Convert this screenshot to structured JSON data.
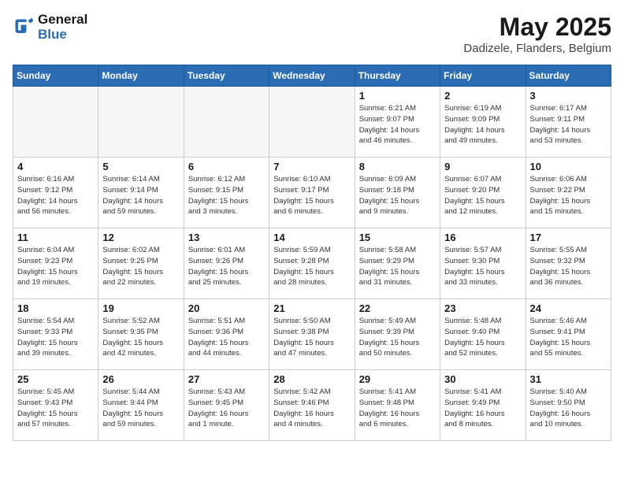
{
  "logo": {
    "line1": "General",
    "line2": "Blue"
  },
  "title": "May 2025",
  "subtitle": "Dadizele, Flanders, Belgium",
  "weekdays": [
    "Sunday",
    "Monday",
    "Tuesday",
    "Wednesday",
    "Thursday",
    "Friday",
    "Saturday"
  ],
  "weeks": [
    [
      {
        "day": "",
        "info": ""
      },
      {
        "day": "",
        "info": ""
      },
      {
        "day": "",
        "info": ""
      },
      {
        "day": "",
        "info": ""
      },
      {
        "day": "1",
        "info": "Sunrise: 6:21 AM\nSunset: 9:07 PM\nDaylight: 14 hours\nand 46 minutes."
      },
      {
        "day": "2",
        "info": "Sunrise: 6:19 AM\nSunset: 9:09 PM\nDaylight: 14 hours\nand 49 minutes."
      },
      {
        "day": "3",
        "info": "Sunrise: 6:17 AM\nSunset: 9:11 PM\nDaylight: 14 hours\nand 53 minutes."
      }
    ],
    [
      {
        "day": "4",
        "info": "Sunrise: 6:16 AM\nSunset: 9:12 PM\nDaylight: 14 hours\nand 56 minutes."
      },
      {
        "day": "5",
        "info": "Sunrise: 6:14 AM\nSunset: 9:14 PM\nDaylight: 14 hours\nand 59 minutes."
      },
      {
        "day": "6",
        "info": "Sunrise: 6:12 AM\nSunset: 9:15 PM\nDaylight: 15 hours\nand 3 minutes."
      },
      {
        "day": "7",
        "info": "Sunrise: 6:10 AM\nSunset: 9:17 PM\nDaylight: 15 hours\nand 6 minutes."
      },
      {
        "day": "8",
        "info": "Sunrise: 6:09 AM\nSunset: 9:18 PM\nDaylight: 15 hours\nand 9 minutes."
      },
      {
        "day": "9",
        "info": "Sunrise: 6:07 AM\nSunset: 9:20 PM\nDaylight: 15 hours\nand 12 minutes."
      },
      {
        "day": "10",
        "info": "Sunrise: 6:06 AM\nSunset: 9:22 PM\nDaylight: 15 hours\nand 15 minutes."
      }
    ],
    [
      {
        "day": "11",
        "info": "Sunrise: 6:04 AM\nSunset: 9:23 PM\nDaylight: 15 hours\nand 19 minutes."
      },
      {
        "day": "12",
        "info": "Sunrise: 6:02 AM\nSunset: 9:25 PM\nDaylight: 15 hours\nand 22 minutes."
      },
      {
        "day": "13",
        "info": "Sunrise: 6:01 AM\nSunset: 9:26 PM\nDaylight: 15 hours\nand 25 minutes."
      },
      {
        "day": "14",
        "info": "Sunrise: 5:59 AM\nSunset: 9:28 PM\nDaylight: 15 hours\nand 28 minutes."
      },
      {
        "day": "15",
        "info": "Sunrise: 5:58 AM\nSunset: 9:29 PM\nDaylight: 15 hours\nand 31 minutes."
      },
      {
        "day": "16",
        "info": "Sunrise: 5:57 AM\nSunset: 9:30 PM\nDaylight: 15 hours\nand 33 minutes."
      },
      {
        "day": "17",
        "info": "Sunrise: 5:55 AM\nSunset: 9:32 PM\nDaylight: 15 hours\nand 36 minutes."
      }
    ],
    [
      {
        "day": "18",
        "info": "Sunrise: 5:54 AM\nSunset: 9:33 PM\nDaylight: 15 hours\nand 39 minutes."
      },
      {
        "day": "19",
        "info": "Sunrise: 5:52 AM\nSunset: 9:35 PM\nDaylight: 15 hours\nand 42 minutes."
      },
      {
        "day": "20",
        "info": "Sunrise: 5:51 AM\nSunset: 9:36 PM\nDaylight: 15 hours\nand 44 minutes."
      },
      {
        "day": "21",
        "info": "Sunrise: 5:50 AM\nSunset: 9:38 PM\nDaylight: 15 hours\nand 47 minutes."
      },
      {
        "day": "22",
        "info": "Sunrise: 5:49 AM\nSunset: 9:39 PM\nDaylight: 15 hours\nand 50 minutes."
      },
      {
        "day": "23",
        "info": "Sunrise: 5:48 AM\nSunset: 9:40 PM\nDaylight: 15 hours\nand 52 minutes."
      },
      {
        "day": "24",
        "info": "Sunrise: 5:46 AM\nSunset: 9:41 PM\nDaylight: 15 hours\nand 55 minutes."
      }
    ],
    [
      {
        "day": "25",
        "info": "Sunrise: 5:45 AM\nSunset: 9:43 PM\nDaylight: 15 hours\nand 57 minutes."
      },
      {
        "day": "26",
        "info": "Sunrise: 5:44 AM\nSunset: 9:44 PM\nDaylight: 15 hours\nand 59 minutes."
      },
      {
        "day": "27",
        "info": "Sunrise: 5:43 AM\nSunset: 9:45 PM\nDaylight: 16 hours\nand 1 minute."
      },
      {
        "day": "28",
        "info": "Sunrise: 5:42 AM\nSunset: 9:46 PM\nDaylight: 16 hours\nand 4 minutes."
      },
      {
        "day": "29",
        "info": "Sunrise: 5:41 AM\nSunset: 9:48 PM\nDaylight: 16 hours\nand 6 minutes."
      },
      {
        "day": "30",
        "info": "Sunrise: 5:41 AM\nSunset: 9:49 PM\nDaylight: 16 hours\nand 8 minutes."
      },
      {
        "day": "31",
        "info": "Sunrise: 5:40 AM\nSunset: 9:50 PM\nDaylight: 16 hours\nand 10 minutes."
      }
    ]
  ]
}
